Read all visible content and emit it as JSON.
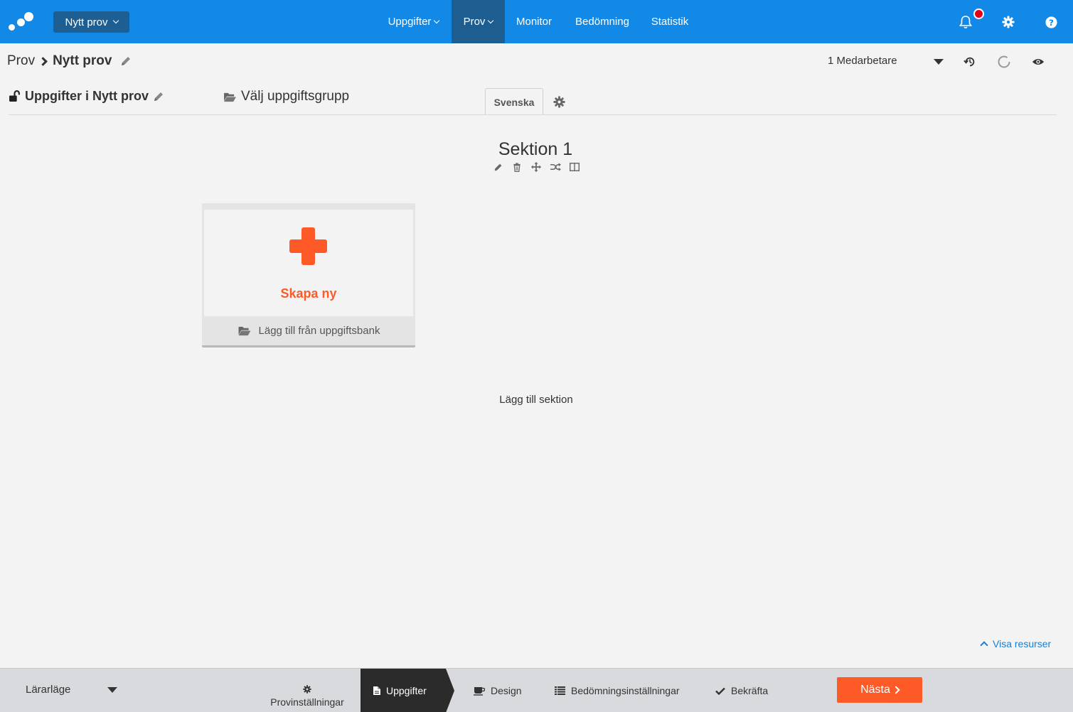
{
  "topbar": {
    "test_menu_label": "Nytt prov",
    "nav": [
      {
        "label": "Uppgifter",
        "has_menu": true
      },
      {
        "label": "Prov",
        "has_menu": true,
        "active": true
      },
      {
        "label": "Monitor"
      },
      {
        "label": "Bedömning"
      },
      {
        "label": "Statistik"
      }
    ],
    "icons": [
      "bell-icon",
      "gear-icon",
      "help-icon"
    ],
    "accent_color": "#1289e6"
  },
  "breadcrumb": {
    "root": "Prov",
    "current": "Nytt prov"
  },
  "collaborators": "1 Medarbetare",
  "tasks_header": {
    "title": "Uppgifter i Nytt prov",
    "pick_group": "Välj uppgiftsgrupp",
    "language_tab": "Svenska"
  },
  "section": {
    "title": "Sektion 1",
    "tools": [
      "pencil-icon",
      "trash-icon",
      "move-icon",
      "shuffle-icon",
      "columns-icon"
    ]
  },
  "card": {
    "create_label": "Skapa ny",
    "bank_label": "Lägg till från uppgiftsbank",
    "accent_color": "#fd5a28"
  },
  "add_section_label": "Lägg till sektion",
  "show_resources_label": "Visa resurser",
  "bottombar": {
    "mode": "Lärarläge",
    "steps": [
      {
        "label": "Provinställningar",
        "icon": "gear-icon"
      },
      {
        "label": "Uppgifter",
        "icon": "document-icon",
        "active": true
      },
      {
        "label": "Design",
        "icon": "cup-icon"
      },
      {
        "label": "Bedömningsinställningar",
        "icon": "list-icon"
      },
      {
        "label": "Bekräfta",
        "icon": "check-icon"
      }
    ],
    "next_label": "Nästa"
  }
}
